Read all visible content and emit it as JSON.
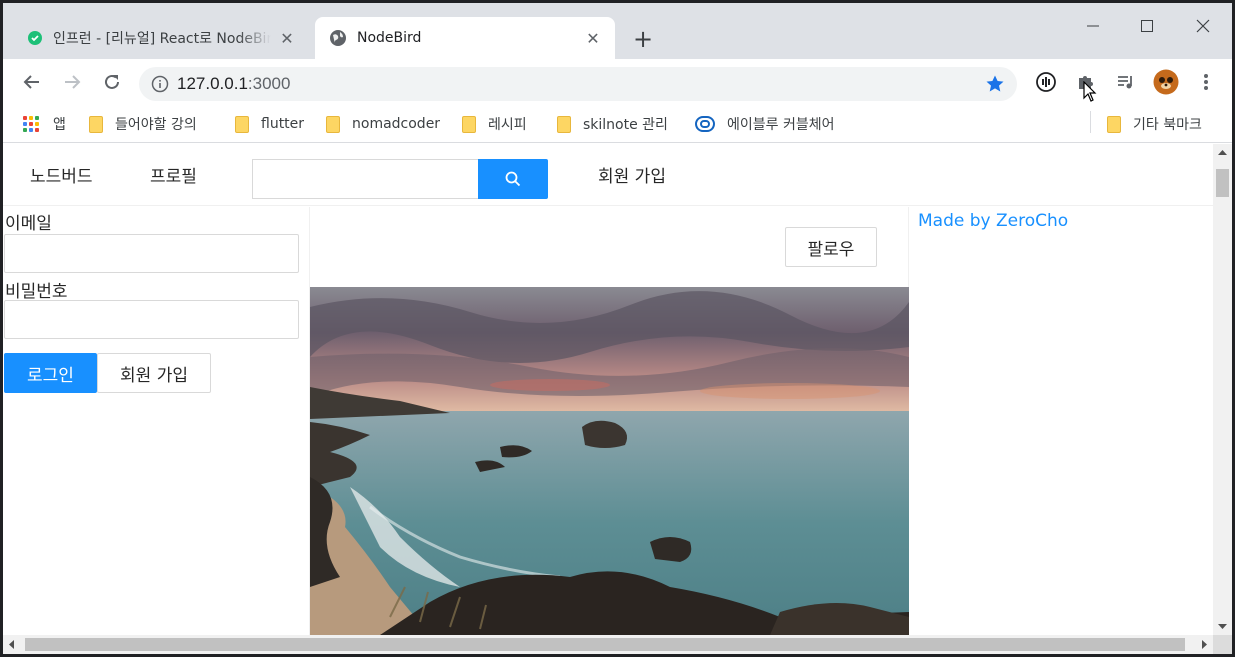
{
  "browser": {
    "tabs": [
      {
        "title": "인프런 - [리뉴얼] React로 NodeBird",
        "icon": "inflearn-favicon",
        "close": "✕"
      },
      {
        "title": "NodeBird",
        "icon": "globe-favicon",
        "close": "✕"
      }
    ],
    "new_tab": "+",
    "window_controls": {
      "minimize": "—",
      "maximize": "☐",
      "close": "✕"
    },
    "address": {
      "host": "127.0.0.1",
      "port": ":3000"
    },
    "bookmarks": [
      {
        "label": "앱",
        "icon": "apps-grid-icon"
      },
      {
        "label": "들어야할 강의",
        "icon": "folder-icon"
      },
      {
        "label": "flutter",
        "icon": "folder-icon"
      },
      {
        "label": "nomadcoder",
        "icon": "folder-icon"
      },
      {
        "label": "레시피",
        "icon": "folder-icon"
      },
      {
        "label": "skilnote 관리",
        "icon": "folder-icon"
      },
      {
        "label": "에이블루 커블체어",
        "icon": "ablue-icon"
      },
      {
        "label": "기타 북마크",
        "icon": "folder-icon"
      }
    ],
    "accent_color": "#1a73e8"
  },
  "app": {
    "menu": {
      "home": "노드버드",
      "profile": "프로필",
      "signup": "회원 가입"
    },
    "search": {
      "placeholder": ""
    },
    "login_form": {
      "email_label": "이메일",
      "email_value": "",
      "password_label": "비밀번호",
      "password_value": "",
      "login_button": "로그인",
      "signup_button": "회원 가입"
    },
    "post": {
      "follow_button": "팔로우",
      "image_description": "coastal-sunset-photo"
    },
    "footer_link": "Made by ZeroCho",
    "primary_color": "#1890ff"
  }
}
